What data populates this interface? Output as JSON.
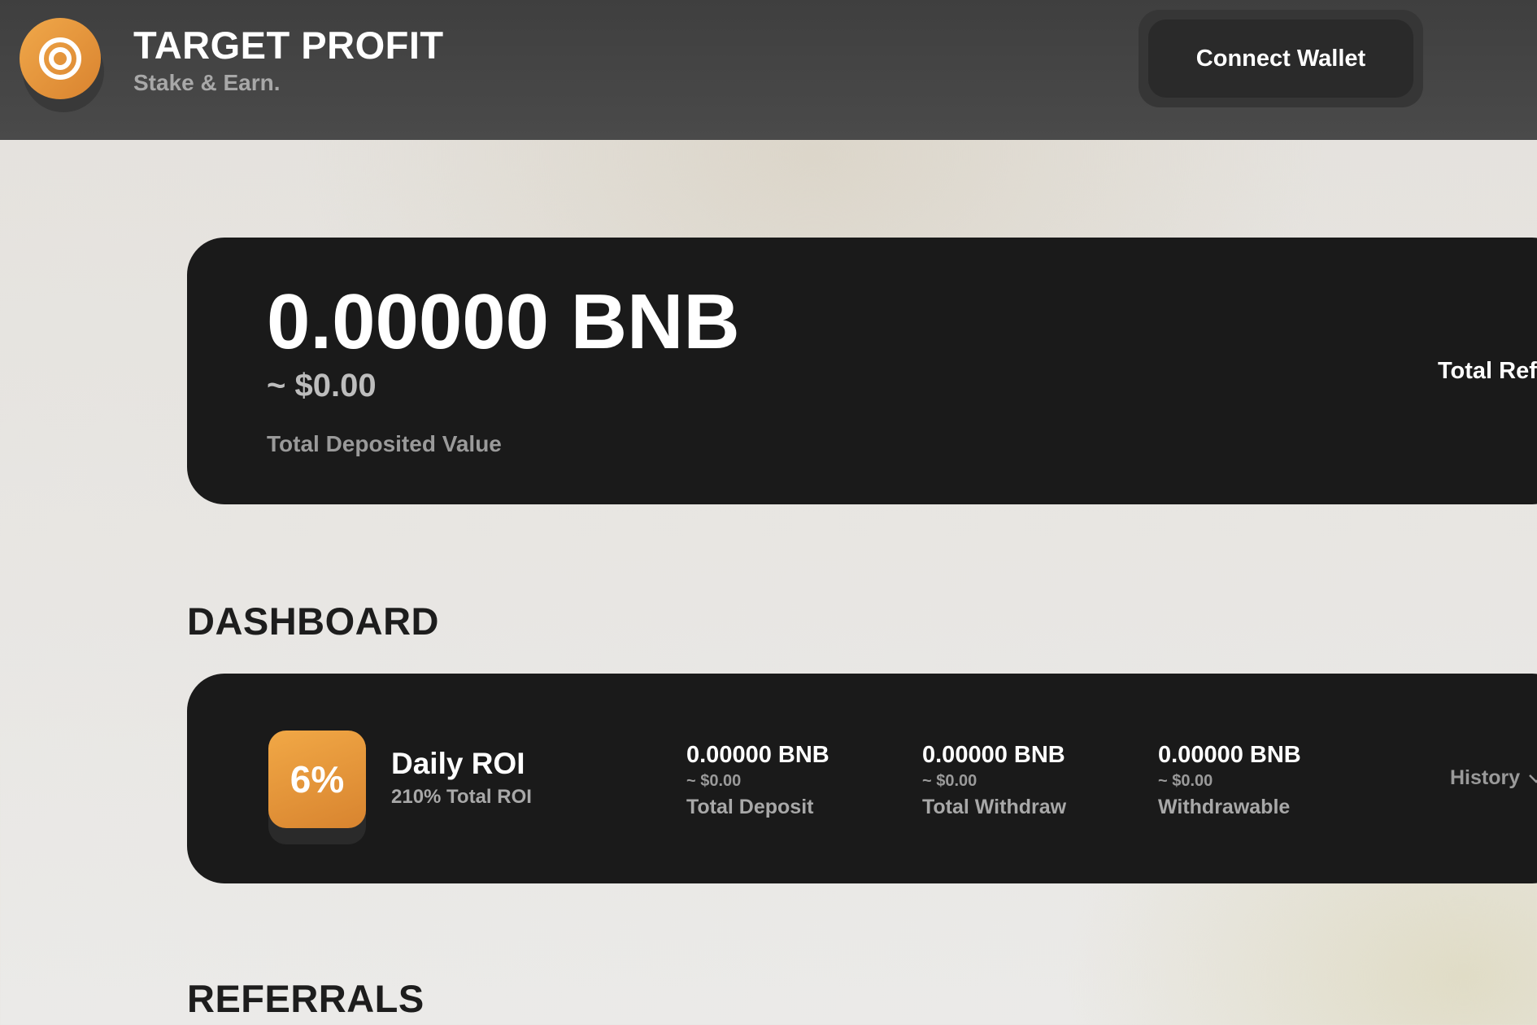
{
  "header": {
    "brand_title": "TARGET PROFIT",
    "brand_subtitle": "Stake & Earn.",
    "logo_icon": "target-icon",
    "connect_wallet_label": "Connect Wallet",
    "accent_color": "#e8993d"
  },
  "total_card": {
    "bnb_value": "0.00000 BNB",
    "usd_value": "~ $0.00",
    "label": "Total Deposited Value",
    "referral_label_partial": "Total Refe"
  },
  "dashboard": {
    "title": "DASHBOARD",
    "roi_badge": "6%",
    "roi_title": "Daily ROI",
    "roi_subtitle": "210% Total ROI",
    "stats": [
      {
        "bnb": "0.00000 BNB",
        "usd": "~ $0.00",
        "label": "Total Deposit"
      },
      {
        "bnb": "0.00000 BNB",
        "usd": "~ $0.00",
        "label": "Total Withdraw"
      },
      {
        "bnb": "0.00000 BNB",
        "usd": "~ $0.00",
        "label": "Withdrawable"
      }
    ],
    "history_label": "History",
    "history_icon": "chevron-down-icon"
  },
  "referrals": {
    "title": "REFERRALS"
  }
}
